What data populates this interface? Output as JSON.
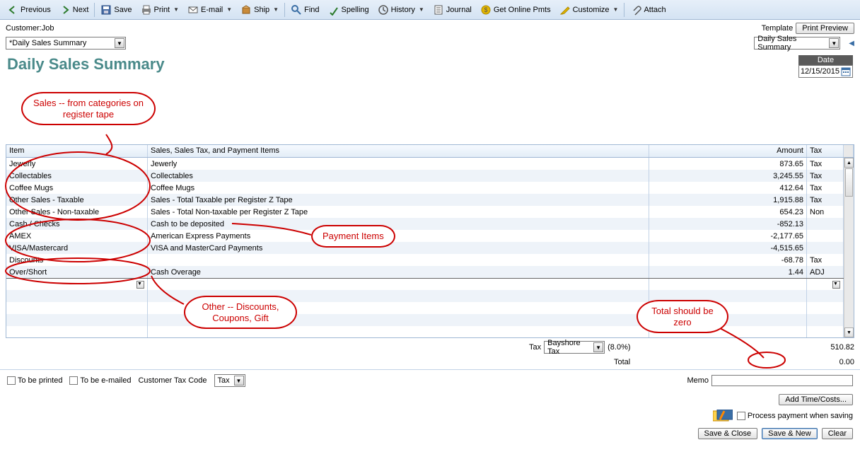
{
  "toolbar": {
    "previous": "Previous",
    "next": "Next",
    "save": "Save",
    "print": "Print",
    "email": "E-mail",
    "ship": "Ship",
    "find": "Find",
    "spelling": "Spelling",
    "history": "History",
    "journal": "Journal",
    "get_online_pmts": "Get Online Pmts",
    "customize": "Customize",
    "attach": "Attach"
  },
  "header": {
    "customer_job_label": "Customer:Job",
    "customer_job_combo": "*Daily Sales Summary",
    "template_label": "Template",
    "template_combo": "Daily Sales Summary",
    "print_preview_btn": "Print Preview"
  },
  "title": "Daily Sales Summary",
  "date": {
    "label": "Date",
    "value": "12/15/2015"
  },
  "grid": {
    "columns": {
      "item": "Item",
      "desc": "Sales, Sales Tax, and Payment Items",
      "amount": "Amount",
      "tax": "Tax"
    },
    "rows": [
      {
        "item": "Jewerly",
        "desc": "Jewerly",
        "amount": "873.65",
        "tax": "Tax"
      },
      {
        "item": "Collectables",
        "desc": "Collectables",
        "amount": "3,245.55",
        "tax": "Tax"
      },
      {
        "item": "Coffee Mugs",
        "desc": "Coffee Mugs",
        "amount": "412.64",
        "tax": "Tax"
      },
      {
        "item": "Other Sales - Taxable",
        "desc": "Sales - Total Taxable per Register Z Tape",
        "amount": "1,915.88",
        "tax": "Tax"
      },
      {
        "item": "Other Sales - Non-taxable",
        "desc": "Sales - Total Non-taxable per Register Z Tape",
        "amount": "654.23",
        "tax": "Non"
      },
      {
        "item": "Cash / Checks",
        "desc": "Cash to be deposited",
        "amount": "-852.13",
        "tax": ""
      },
      {
        "item": "AMEX",
        "desc": "American Express Payments",
        "amount": "-2,177.65",
        "tax": ""
      },
      {
        "item": "VISA/Mastercard",
        "desc": "VISA and MasterCard Payments",
        "amount": "-4,515.65",
        "tax": ""
      },
      {
        "item": "Discounts",
        "desc": "",
        "amount": "-68.78",
        "tax": "Tax"
      },
      {
        "item": "Over/Short",
        "desc": "Cash Overage",
        "amount": "1.44",
        "tax": "ADJ"
      }
    ]
  },
  "totals": {
    "tax_label": "Tax",
    "tax_combo": "Bayshore Tax",
    "tax_rate": "(8.0%)",
    "tax_amount": "510.82",
    "total_label": "Total",
    "total_amount": "0.00"
  },
  "footer": {
    "to_be_printed": "To be printed",
    "to_be_emailed": "To be e-mailed",
    "cust_tax_code_label": "Customer Tax Code",
    "cust_tax_code": "Tax",
    "memo_label": "Memo",
    "add_time_costs": "Add Time/Costs...",
    "process_payment": "Process  payment when saving",
    "save_close": "Save & Close",
    "save_new": "Save & New",
    "clear": "Clear"
  },
  "callouts": {
    "sales": "Sales --  from categories on register tape",
    "payment": "Payment Items",
    "other": "Other -- Discounts, Coupons, Gift",
    "total": "Total should be zero"
  }
}
